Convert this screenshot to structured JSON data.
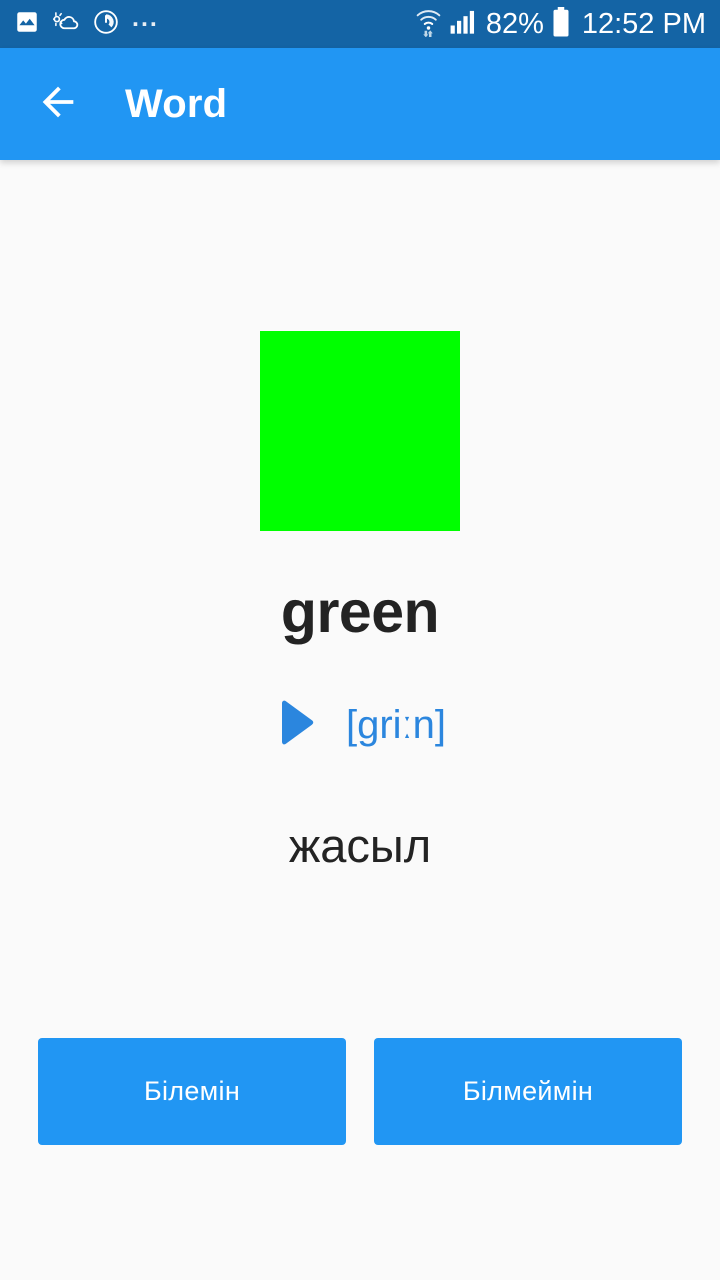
{
  "status_bar": {
    "background_color": "#1464a5",
    "left_icons": [
      {
        "name": "image-icon"
      },
      {
        "name": "weather-icon"
      },
      {
        "name": "power-timer-icon"
      }
    ],
    "overflow_dots": "...",
    "wifi_icon": "wifi-icon",
    "signal_icon": "cellular-signal-icon",
    "battery_percent": "82%",
    "battery_icon": "battery-icon",
    "time": "12:52 PM"
  },
  "app_bar": {
    "background_color": "#2196f3",
    "back_icon": "back-arrow-icon",
    "title": "Word"
  },
  "card": {
    "image_color": "#00ff00",
    "image_alt": "green-color-swatch",
    "term": "green",
    "play_icon": "play-icon",
    "pronunciation": "[griːn]",
    "pronunciation_color": "#2b86de",
    "translation": "жасыл"
  },
  "actions": {
    "know_label": "Білемін",
    "dont_know_label": "Білмеймін",
    "button_color": "#2196f3"
  }
}
